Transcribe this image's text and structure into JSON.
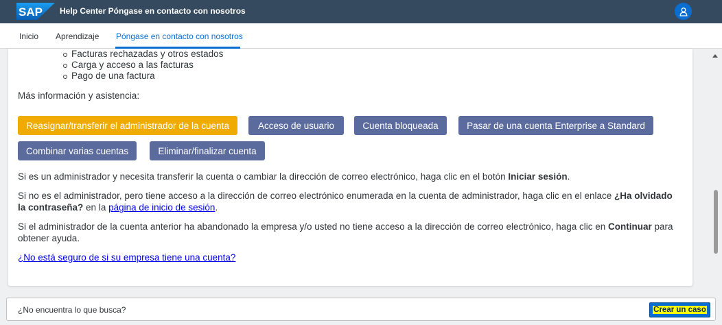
{
  "header": {
    "logo_text": "SAP",
    "title": "Help Center Póngase en contacto con nosotros",
    "user_icon": "user-icon"
  },
  "nav": {
    "tabs": [
      {
        "label": "Inicio"
      },
      {
        "label": "Aprendizaje"
      },
      {
        "label": "Póngase en contacto con nosotros",
        "active": true
      }
    ]
  },
  "content": {
    "bullets": [
      "Facturas rechazadas y otros estados",
      "Carga y acceso a las facturas",
      "Pago de una factura"
    ],
    "more_info": "Más información y asistencia:",
    "buttons": [
      {
        "label": "Reasignar/transferir el administrador de la cuenta",
        "style": "orange"
      },
      {
        "label": "Acceso de usuario",
        "style": "slate"
      },
      {
        "label": "Cuenta bloqueada",
        "style": "slate"
      },
      {
        "label": "Pasar de una cuenta Enterprise a Standard",
        "style": "slate"
      },
      {
        "label": "Combinar varias cuentas",
        "style": "slate"
      },
      {
        "label": "Eliminar/finalizar cuenta",
        "style": "slate"
      }
    ],
    "p1_text": "Si es un administrador y necesita transferir la cuenta o cambiar la dirección de correo electrónico, haga clic en el botón ",
    "p1_bold": "Iniciar sesión",
    "p1_end": ".",
    "p2_text": "Si no es el administrador, pero tiene acceso a la dirección de correo electrónico enumerada en la cuenta de administrador, haga clic en el enlace ",
    "p2_bold": "¿Ha olvidado la contraseña?",
    "p2_mid": " en la ",
    "p2_link": "página de inicio de sesión",
    "p2_end": ".",
    "p3_text": "Si el administrador de la cuenta anterior ha abandonado la empresa y/o usted no tiene acceso a la dirección de correo electrónico, haga clic en ",
    "p3_bold": "Continuar",
    "p3_end": " para obtener ayuda.",
    "help_link": "¿No está seguro de si su empresa tiene una cuenta?"
  },
  "footer": {
    "question": "¿No encuentra lo que busca?",
    "create_case": "Crear un caso"
  },
  "colors": {
    "shell": "#354a5f",
    "accent": "#0a6ed1",
    "orange_button": "#f0ab00",
    "slate_button": "#5b6b9e"
  }
}
